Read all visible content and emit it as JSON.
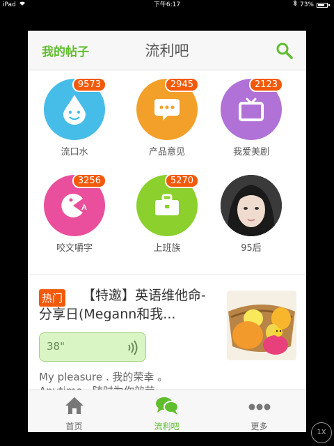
{
  "status": {
    "device": "iPad",
    "time": "下午6:17",
    "battery": "73%"
  },
  "nav": {
    "left_label": "我的帖子",
    "title": "流利吧"
  },
  "groups": [
    {
      "label": "流口水",
      "count": "9573",
      "color": "#46bde8",
      "icon": "drop-face-icon"
    },
    {
      "label": "产品意见",
      "count": "2945",
      "color": "#f3a02a",
      "icon": "speech-bubble-icon"
    },
    {
      "label": "我爱美剧",
      "count": "2123",
      "color": "#b072d6",
      "icon": "tv-icon"
    },
    {
      "label": "咬文嚼字",
      "count": "3256",
      "color": "#e94f9c",
      "icon": "pacman-icon"
    },
    {
      "label": "上班族",
      "count": "5270",
      "color": "#8bd02c",
      "icon": "briefcase-icon"
    },
    {
      "label": "95后",
      "count": "",
      "color": "#444444",
      "icon": "avatar"
    }
  ],
  "post": {
    "tag": "热门",
    "title": "【特邀】英语维他命-分享日(Megann和我...",
    "voice_duration": "38\"",
    "text_line1": "My pleasure . 我的荣幸 。",
    "text_line2": "Anytime . 随时为你效劳"
  },
  "tabs": [
    {
      "label": "首页",
      "icon": "home-icon",
      "active": false
    },
    {
      "label": "流利吧",
      "icon": "chat-bubbles-icon",
      "active": true
    },
    {
      "label": "更多",
      "icon": "more-dots-icon",
      "active": false
    }
  ],
  "zoom_label": "1X",
  "colors": {
    "accent_green": "#5fbe2e",
    "badge_orange": "#f25a0a"
  }
}
